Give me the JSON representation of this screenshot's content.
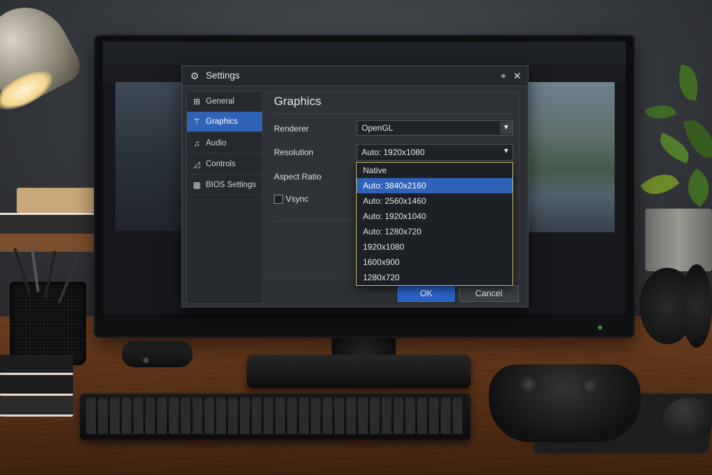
{
  "dialog": {
    "title": "Settings",
    "close_glyph": "✕",
    "pin_glyph": "⌖"
  },
  "sidebar": {
    "items": [
      {
        "label": "General",
        "icon": "grid-icon",
        "glyph": "⊞",
        "active": false
      },
      {
        "label": "Graphics",
        "icon": "graphics-icon",
        "glyph": "⚚",
        "active": true
      },
      {
        "label": "Audio",
        "icon": "audio-icon",
        "glyph": "♫",
        "active": false
      },
      {
        "label": "Controls",
        "icon": "controls-icon",
        "glyph": "◿",
        "active": false
      },
      {
        "label": "BIOS Settings",
        "icon": "bios-icon",
        "glyph": "▦",
        "active": false
      }
    ]
  },
  "graphics": {
    "title": "Graphics",
    "renderer_label": "Renderer",
    "renderer_value": "OpenGL",
    "resolution_label": "Resolution",
    "resolution_value": "Auto: 1920x1080",
    "aspect_label": "Aspect Ratio",
    "vsync_label": "Vsync"
  },
  "resolution_dropdown": {
    "options": [
      "Native",
      "Auto: 3840x2160",
      "Auto: 2560x1460",
      "Auto: 1920x1040",
      "Auto: 1280x720",
      "1920x1080",
      "1600x900",
      "1280x720"
    ],
    "highlighted_index": 1
  },
  "buttons": {
    "ok": "OK",
    "cancel": "Cancel"
  },
  "colors": {
    "accent": "#2f63b8",
    "dropdown_border": "#c8c070"
  }
}
